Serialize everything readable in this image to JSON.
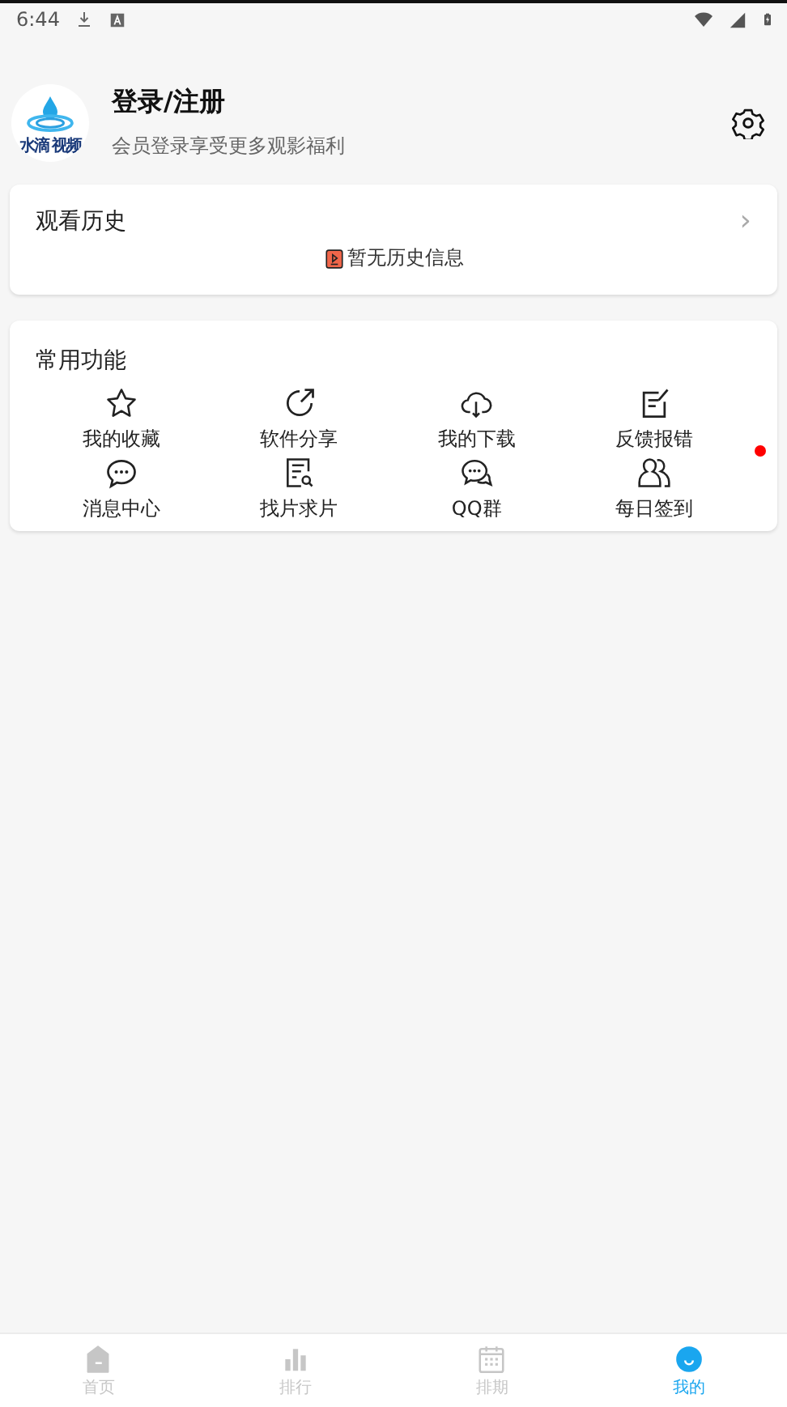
{
  "status_bar": {
    "time": "6:44"
  },
  "profile": {
    "logo_text": "水滴 视频",
    "title": "登录/注册",
    "subtitle": "会员登录享受更多观影福利"
  },
  "history": {
    "title": "观看历史",
    "chevron": "›",
    "empty_text": "暂无历史信息"
  },
  "functions": {
    "title": "常用功能",
    "items": [
      {
        "label": "我的收藏",
        "dot": false
      },
      {
        "label": "软件分享",
        "dot": false
      },
      {
        "label": "我的下载",
        "dot": false
      },
      {
        "label": "反馈报错",
        "dot": false
      },
      {
        "label": "消息中心",
        "dot": false
      },
      {
        "label": "找片求片",
        "dot": false
      },
      {
        "label": "QQ群",
        "dot": false
      },
      {
        "label": "每日签到",
        "dot": true
      }
    ]
  },
  "bottom_nav": [
    {
      "label": "首页",
      "selected": false
    },
    {
      "label": "排行",
      "selected": false
    },
    {
      "label": "排期",
      "selected": false
    },
    {
      "label": "我的",
      "selected": true
    }
  ]
}
